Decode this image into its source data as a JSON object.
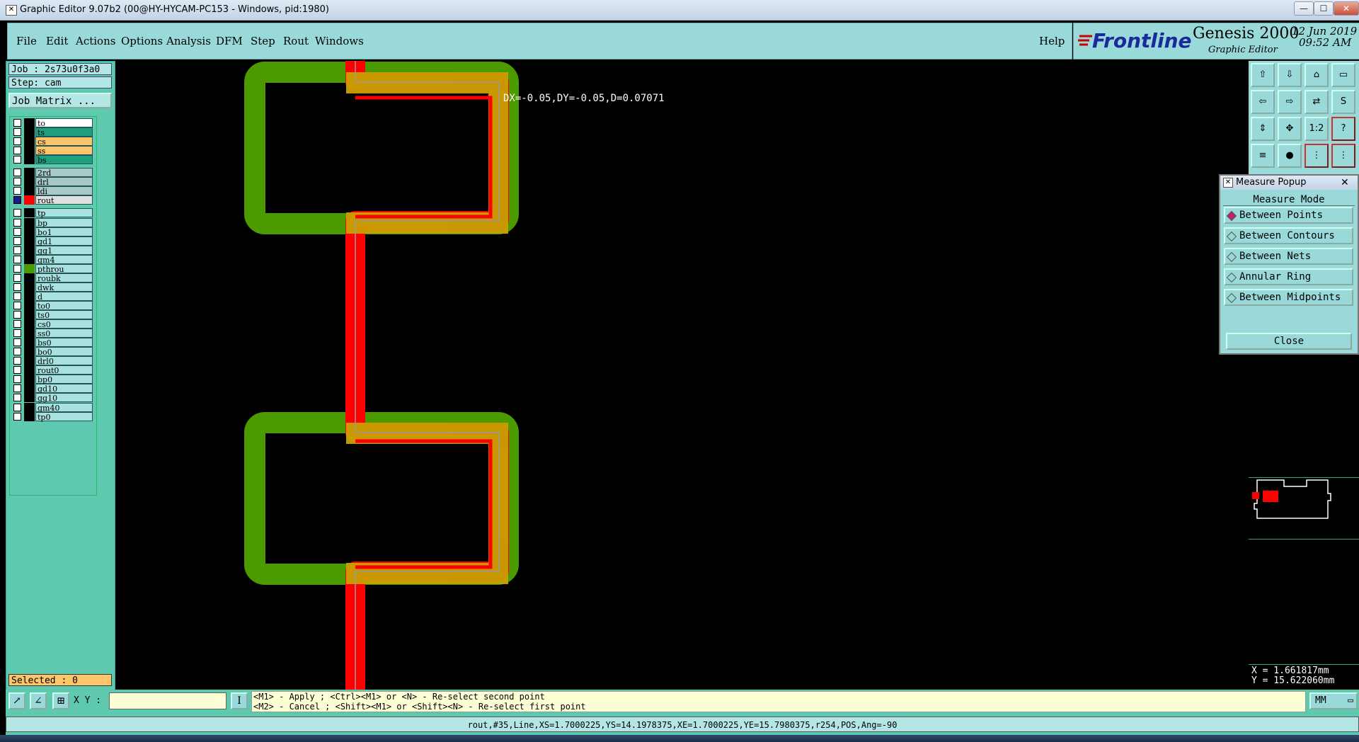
{
  "window": {
    "title": "Graphic Editor 9.07b2 (00@HY-HYCAM-PC153 - Windows, pid:1980)",
    "minimize": "—",
    "maximize": "☐",
    "close": "✕"
  },
  "menu": {
    "items": [
      "File",
      "Edit",
      "Actions",
      "Options",
      "Analysis",
      "DFM",
      "Step",
      "Rout",
      "Windows"
    ],
    "help": "Help"
  },
  "brand": {
    "logo": "Frontline",
    "product": "Genesis 2000",
    "subtitle": "Graphic Editor",
    "date": "12 Jun 2019",
    "time": "09:52 AM"
  },
  "left": {
    "job": "Job : 2s73u0f3a0",
    "step": "Step: cam",
    "job_matrix": "Job Matrix ...",
    "selected": "Selected : 0"
  },
  "layers": [
    {
      "name": "to",
      "color": "#ffffff"
    },
    {
      "name": "ts",
      "color": "#1fa07c"
    },
    {
      "name": "cs",
      "color": "#ffc56a"
    },
    {
      "name": "ss",
      "color": "#ffc56a"
    },
    {
      "name": "bs",
      "color": "#1fa07c"
    },
    {
      "name": "2rd",
      "color": "#a9c9c9"
    },
    {
      "name": "drl",
      "color": "#a9c9c9"
    },
    {
      "name": "ldi",
      "color": "#a9c9c9"
    },
    {
      "name": "rout",
      "color": "#e0e0e0"
    },
    {
      "name": "tp",
      "color": "#a9e0e0"
    },
    {
      "name": "bp",
      "color": "#a9e0e0"
    },
    {
      "name": "bo1",
      "color": "#a9e0e0"
    },
    {
      "name": "gd1",
      "color": "#a9e0e0"
    },
    {
      "name": "gg1",
      "color": "#a9e0e0"
    },
    {
      "name": "gm4",
      "color": "#a9e0e0"
    },
    {
      "name": "pthrou",
      "color": "#a9e0e0"
    },
    {
      "name": "roubk",
      "color": "#a9e0e0"
    },
    {
      "name": "dwk",
      "color": "#a9e0e0"
    },
    {
      "name": "d",
      "color": "#a9e0e0"
    },
    {
      "name": "to0",
      "color": "#a9e0e0"
    },
    {
      "name": "ts0",
      "color": "#a9e0e0"
    },
    {
      "name": "cs0",
      "color": "#a9e0e0"
    },
    {
      "name": "ss0",
      "color": "#a9e0e0"
    },
    {
      "name": "bs0",
      "color": "#a9e0e0"
    },
    {
      "name": "bo0",
      "color": "#a9e0e0"
    },
    {
      "name": "drl0",
      "color": "#a9e0e0"
    },
    {
      "name": "rout0",
      "color": "#a9e0e0"
    },
    {
      "name": "bp0",
      "color": "#a9e0e0"
    },
    {
      "name": "gd10",
      "color": "#a9e0e0"
    },
    {
      "name": "gg10",
      "color": "#a9e0e0"
    },
    {
      "name": "gm40",
      "color": "#a9e0e0"
    },
    {
      "name": "tp0",
      "color": "#a9e0e0"
    }
  ],
  "canvas": {
    "measure_text": "DX=-0.05,DY=-0.05,D=0.07071"
  },
  "measure_popup": {
    "title": "Measure Popup",
    "mode_header": "Measure Mode",
    "options": [
      "Between Points",
      "Between Contours",
      "Between Nets",
      "Annular Ring",
      "Between Midpoints"
    ],
    "selected": "Between Points",
    "close": "Close"
  },
  "coords": {
    "x": "X =  1.661817mm",
    "y": "Y = 15.622060mm"
  },
  "bottom": {
    "xy_label": "X Y :",
    "xy_value": "",
    "prompt_line1": "<M1> - Apply  ; <Ctrl><M1> or <N> - Re-select second point",
    "prompt_line2": "<M2> - Cancel ; <Shift><M1> or <Shift><N> - Re-select first point",
    "units": "MM",
    "status": "rout,#35,Line,XS=1.7000225,YS=14.1978375,XE=1.7000225,YE=15.7980375,r254,POS,Ang=-90"
  },
  "colors": {
    "accent": "#9ad9d9",
    "panel": "#5fc9b0",
    "route_red": "#ff0000",
    "pad_green": "#4a9a00",
    "overlap_yellow": "#c8a000"
  }
}
